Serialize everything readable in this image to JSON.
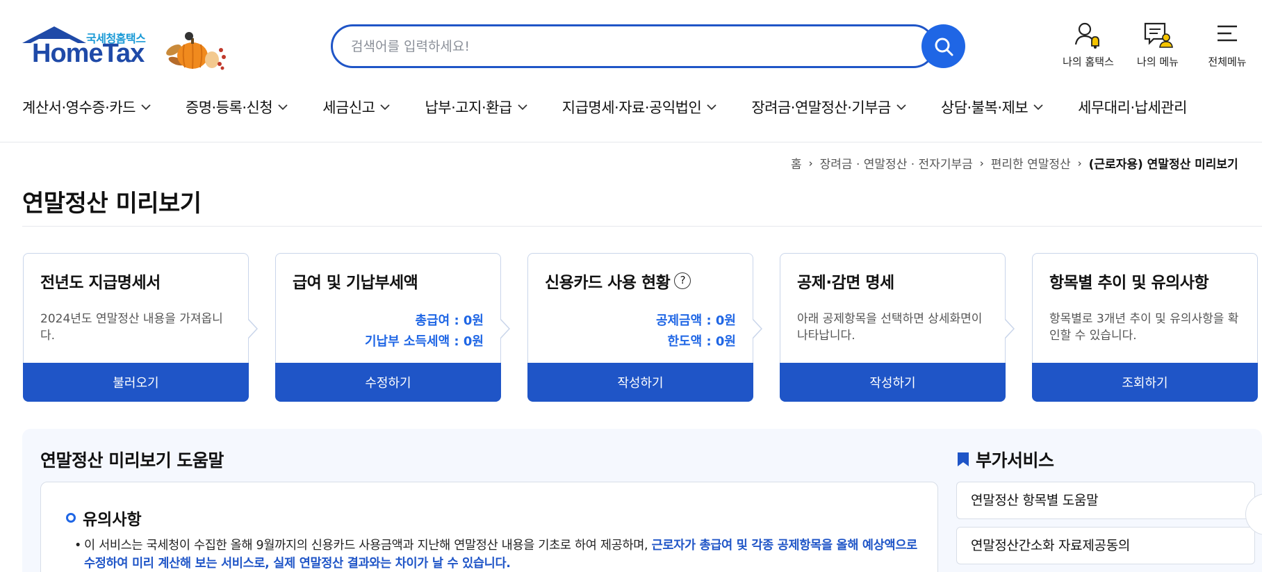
{
  "header": {
    "logo": {
      "sub": "국세청홈택스",
      "main": "HomeTax"
    },
    "search": {
      "placeholder": "검색어를 입력하세요!"
    },
    "top_icons": [
      {
        "icon": "user-bell-icon",
        "label": "나의 홈택스"
      },
      {
        "icon": "menu-user-icon",
        "label": "나의 메뉴"
      },
      {
        "icon": "hamburger-icon",
        "label": "전체메뉴"
      }
    ],
    "gnb": [
      "계산서·영수증·카드",
      "증명·등록·신청",
      "세금신고",
      "납부·고지·환급",
      "지급명세·자료·공익법인",
      "장려금·연말정산·기부금",
      "상담·불복·제보",
      "세무대리·납세관리"
    ]
  },
  "breadcrumb": [
    "홈",
    "장려금 · 연말정산 · 전자기부금",
    "편리한 연말정산",
    "(근로자용) 연말정산 미리보기"
  ],
  "page_title": "연말정산 미리보기",
  "steps": [
    {
      "title": "전년도 지급명세서",
      "desc": "2024년도 연말정산 내용을 가져옵니다.",
      "button": "불러오기"
    },
    {
      "title": "급여 및 기납부세액",
      "vals": [
        "총급여 : 0원",
        "기납부 소득세액 : 0원"
      ],
      "button": "수정하기"
    },
    {
      "title": "신용카드 사용 현황",
      "help": "?",
      "vals": [
        "공제금액 : 0원",
        "한도액 : 0원"
      ],
      "button": "작성하기"
    },
    {
      "title": "공제·감면 명세",
      "desc": "아래 공제항목을 선택하면 상세화면이 나타납니다.",
      "button": "작성하기"
    },
    {
      "title": "항목별 추이 및 유의사항",
      "desc": "항목별로 3개년 추이 및 유의사항을 확인할 수 있습니다.",
      "button": "조회하기"
    }
  ],
  "help": {
    "title": "연말정산 미리보기 도움말",
    "notice_title": "유의사항",
    "notice_text": "이 서비스는 국세청이 수집한 올해 9월까지의 신용카드 사용금액과 지난해 연말정산 내용을 기초로 하여 제공하며, ",
    "notice_highlight": "근로자가 총급여 및 각종 공제항목을 올해 예상액으로 수정하여 미리 계산해 보는 서비스로, 실제 연말정산 결과와는 차이가 날 수 있습니다."
  },
  "side": {
    "title": "부가서비스",
    "items": [
      "연말정산 항목별 도움말",
      "연말정산간소화 자료제공동의"
    ]
  },
  "colors": {
    "primary": "#1f55c7",
    "accent": "#1f66e5",
    "brand_sub": "#1a9ad6"
  }
}
